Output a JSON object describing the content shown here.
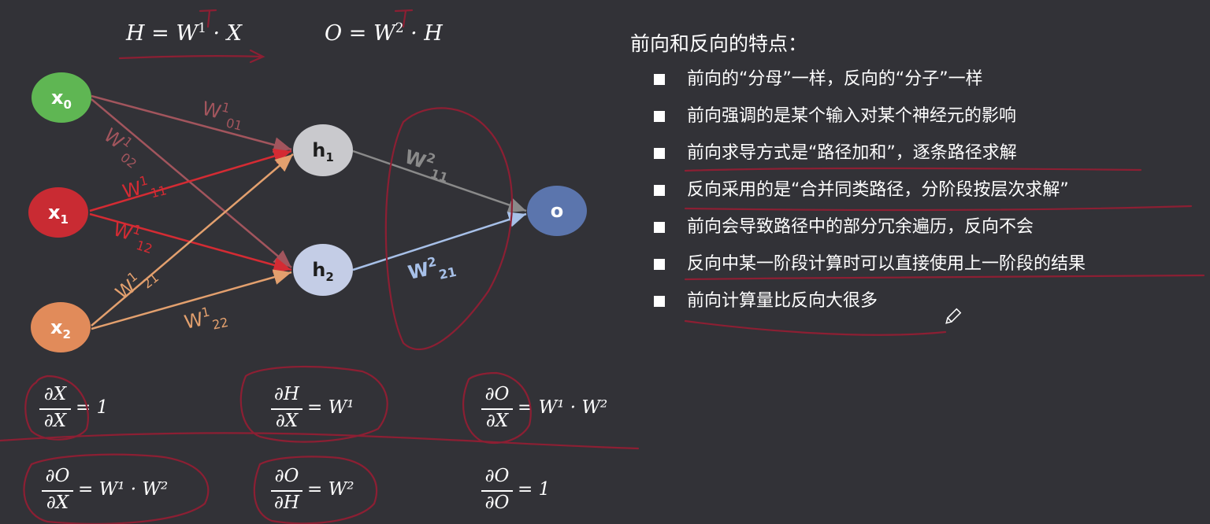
{
  "equations": {
    "hidden": {
      "lhs": "H",
      "weight": "W",
      "sup": "1",
      "input": "X"
    },
    "output": {
      "lhs": "O",
      "weight": "W",
      "sup": "2",
      "input": "H"
    }
  },
  "nodes": {
    "x0": {
      "base": "x",
      "sub": "0",
      "color": "#5fb653"
    },
    "x1": {
      "base": "x",
      "sub": "1",
      "color": "#c92b33"
    },
    "x2": {
      "base": "x",
      "sub": "2",
      "color": "#e18b5a"
    },
    "h1": {
      "base": "h",
      "sub": "1",
      "color": "#c9c9cd"
    },
    "h2": {
      "base": "h",
      "sub": "2",
      "color": "#c4cde6"
    },
    "o": {
      "base": "o",
      "color": "#5b75ad"
    }
  },
  "edge_labels": {
    "w1_01": {
      "base": "W",
      "sup": "1",
      "sub": "01"
    },
    "w1_02": {
      "base": "W",
      "sup": "1",
      "sub": "02"
    },
    "w1_11": {
      "base": "W",
      "sup": "1",
      "sub": "11"
    },
    "w1_12": {
      "base": "W",
      "sup": "1",
      "sub": "12"
    },
    "w1_21": {
      "base": "W",
      "sup": "1",
      "sub": "21"
    },
    "w1_22": {
      "base": "W",
      "sup": "1",
      "sub": "22"
    },
    "w2_11": {
      "base": "W",
      "sup": "2",
      "sub": "11"
    },
    "w2_21": {
      "base": "W",
      "sup": "2",
      "sub": "21"
    }
  },
  "derivatives": [
    {
      "num": "∂X",
      "den": "∂X",
      "rhs": "= 1"
    },
    {
      "num": "∂H",
      "den": "∂X",
      "rhs": "= W¹"
    },
    {
      "num": "∂O",
      "den": "∂X",
      "rhs": "= W¹ · W²"
    },
    {
      "num": "∂O",
      "den": "∂X",
      "rhs": "= W¹ · W²"
    },
    {
      "num": "∂O",
      "den": "∂H",
      "rhs": "= W²"
    },
    {
      "num": "∂O",
      "den": "∂O",
      "rhs": "= 1"
    }
  ],
  "points": {
    "title": "前向和反向的特点：",
    "items": [
      "前向的“分母”一样，反向的“分子”一样",
      "前向强调的是某个输入对某个神经元的影响",
      "前向求导方式是“路径加和”，逐条路径求解",
      "反向采用的是“合并同类路径，分阶段按层次求解”",
      "前向会导致路径中的部分冗余遍历，反向不会",
      "反向中某一阶段计算时可以直接使用上一阶段的结果",
      "前向计算量比反向大很多"
    ]
  },
  "colors": {
    "background": "#323237",
    "annotation": "#8c1f33",
    "edge_x0": "#a2555d",
    "edge_x1": "#d42b33",
    "edge_x2": "#e3a06e",
    "edge_h1": "#8a8a8a",
    "edge_h2": "#a7c0e8"
  }
}
